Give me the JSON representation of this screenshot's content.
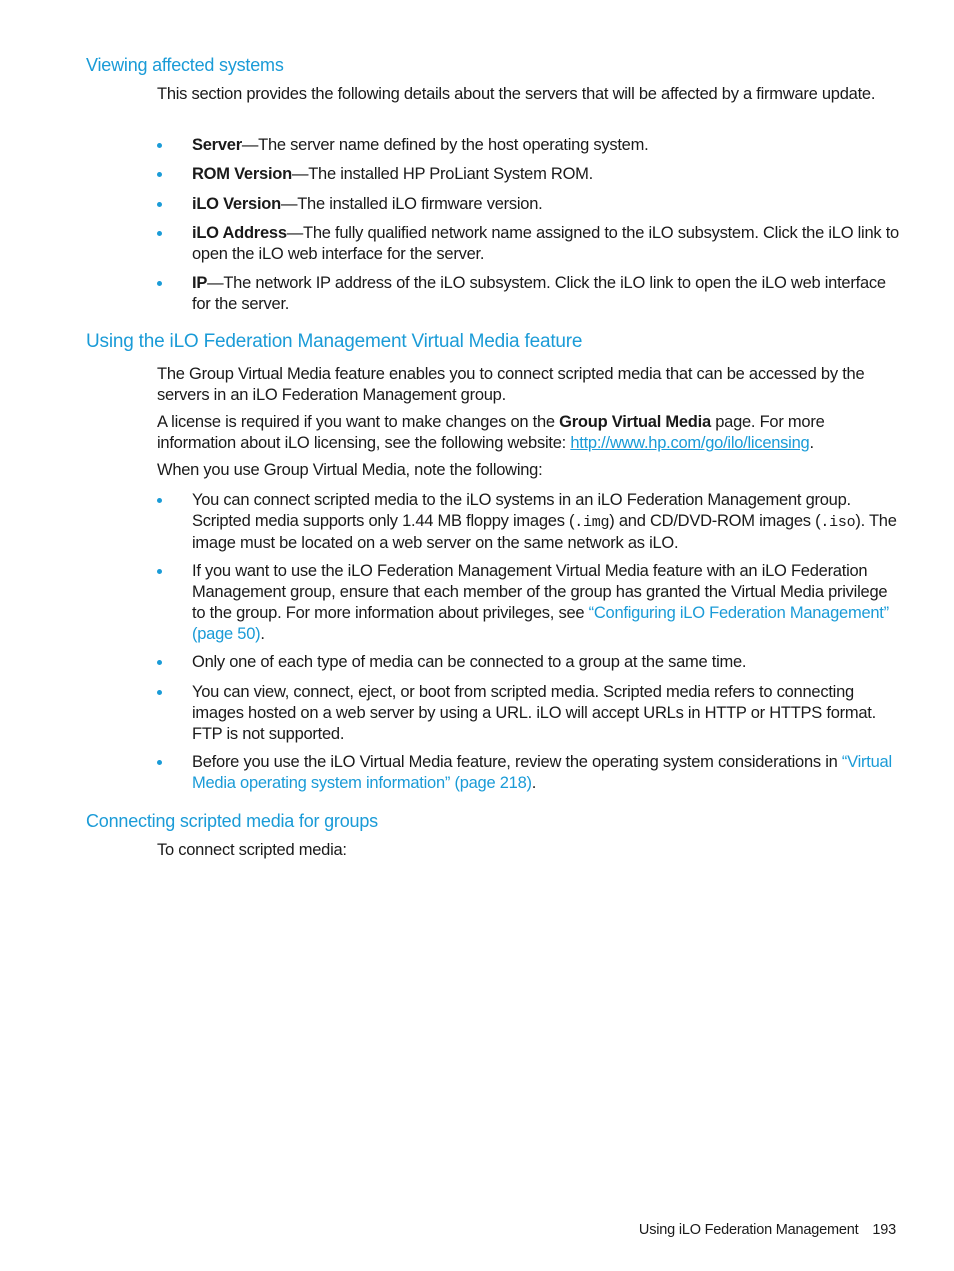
{
  "sections": {
    "viewing": {
      "heading": "Viewing affected systems",
      "intro": "This section provides the following details about the servers that will be affected by a firmware update.",
      "items": [
        {
          "term": "Server",
          "text": "—The server name defined by the host operating system."
        },
        {
          "term": "ROM Version",
          "text": "—The installed HP ProLiant System ROM."
        },
        {
          "term": "iLO Version",
          "text": "—The installed iLO firmware version."
        },
        {
          "term": "iLO Address",
          "text": "—The fully qualified network name assigned to the iLO subsystem. Click the iLO link to open the iLO web interface for the server."
        },
        {
          "term": "IP",
          "text": "—The network IP address of the iLO subsystem. Click the iLO link to open the iLO web interface for the server."
        }
      ]
    },
    "virtual_media": {
      "heading": "Using the iLO Federation Management Virtual Media feature",
      "p1": "The Group Virtual Media feature enables you to connect scripted media that can be accessed by the servers in an iLO Federation Management group.",
      "p2_before": "A license is required if you want to make changes on the ",
      "p2_bold": "Group Virtual Media",
      "p2_after": " page. For more information about iLO licensing, see the following website: ",
      "p2_link": "http://www.hp.com/go/ilo/licensing",
      "p2_end": ".",
      "p3": "When you use Group Virtual Media, note the following:",
      "b1_a": "You can connect scripted media to the iLO systems in an iLO Federation Management group. Scripted media supports only 1.44 MB floppy images (",
      "b1_code1": ".img",
      "b1_b": ") and CD/DVD-ROM images (",
      "b1_code2": ".iso",
      "b1_c": "). The image must be located on a web server on the same network as iLO.",
      "b2_a": "If you want to use the iLO Federation Management Virtual Media feature with an iLO Federation Management group, ensure that each member of the group has granted the Virtual Media privilege to the group. For more information about privileges, see ",
      "b2_link": "“Configuring iLO Federation Management” (page 50)",
      "b2_end": ".",
      "b3": "Only one of each type of media can be connected to a group at the same time.",
      "b4": "You can view, connect, eject, or boot from scripted media. Scripted media refers to connecting images hosted on a web server by using a URL. iLO will accept URLs in HTTP or HTTPS format. FTP is not supported.",
      "b5_a": "Before you use the iLO Virtual Media feature, review the operating system considerations in ",
      "b5_link": "“Virtual Media operating system information” (page 218)",
      "b5_end": "."
    },
    "connecting": {
      "heading": "Connecting scripted media for groups",
      "p1": "To connect scripted media:"
    }
  },
  "footer": {
    "chapter": "Using iLO Federation Management",
    "page_number": "193"
  },
  "colors": {
    "accent": "#1a9bd7",
    "text": "#1a1a1a"
  }
}
